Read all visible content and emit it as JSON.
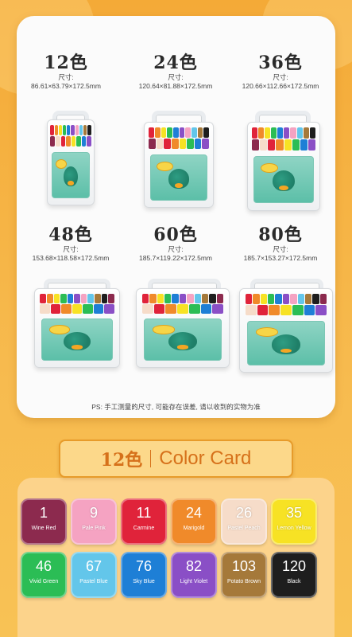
{
  "sizes": [
    {
      "count": "12色",
      "label": "尺寸:",
      "value": "86.61×63.79×172.5mm"
    },
    {
      "count": "24色",
      "label": "尺寸:",
      "value": "120.64×81.88×172.5mm"
    },
    {
      "count": "36色",
      "label": "尺寸:",
      "value": "120.66×112.66×172.5mm"
    },
    {
      "count": "48色",
      "label": "尺寸:",
      "value": "153.68×118.58×172.5mm"
    },
    {
      "count": "60色",
      "label": "尺寸:",
      "value": "185.7×119.22×172.5mm"
    },
    {
      "count": "80色",
      "label": "尺寸:",
      "value": "185.7×153.27×172.5mm"
    }
  ],
  "ps_note": "PS: 手工测量的尺寸, 可能存在误差, 请以收到的实物为准",
  "color_card": {
    "count": "12色",
    "title": "Color Card"
  },
  "swatches": [
    {
      "number": "1",
      "name": "Wine Red",
      "color": "#8c2a4e"
    },
    {
      "number": "9",
      "name": "Pale Pink",
      "color": "#f5a3c2"
    },
    {
      "number": "11",
      "name": "Carmine",
      "color": "#e0233a"
    },
    {
      "number": "24",
      "name": "Marigold",
      "color": "#f08a2a"
    },
    {
      "number": "26",
      "name": "Pastel Peach",
      "color": "#f6dcc9"
    },
    {
      "number": "35",
      "name": "Lemon Yellow",
      "color": "#f7e224"
    },
    {
      "number": "46",
      "name": "Vivid Green",
      "color": "#2bbd55"
    },
    {
      "number": "67",
      "name": "Pastel Blue",
      "color": "#63c6ea"
    },
    {
      "number": "76",
      "name": "Sky Blue",
      "color": "#1e7fd6"
    },
    {
      "number": "82",
      "name": "Light Violet",
      "color": "#8a4fc6"
    },
    {
      "number": "103",
      "name": "Potato Brown",
      "color": "#a5793a"
    },
    {
      "number": "120",
      "name": "Black",
      "color": "#1e1e1e"
    }
  ]
}
